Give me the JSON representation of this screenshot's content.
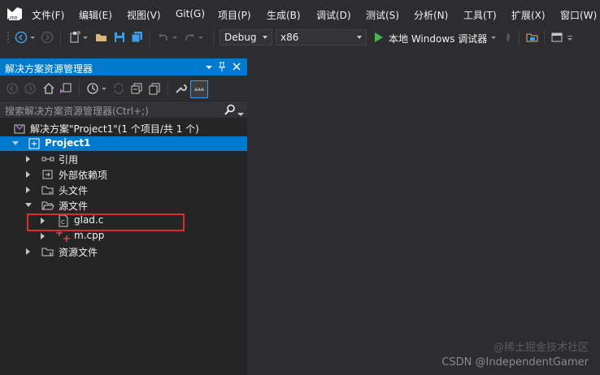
{
  "menubar": {
    "items": [
      "文件(F)",
      "编辑(E)",
      "视图(V)",
      "Git(G)",
      "项目(P)",
      "生成(B)",
      "调试(D)",
      "测试(S)",
      "分析(N)",
      "工具(T)",
      "扩展(X)",
      "窗口(W)"
    ],
    "logo_badge": "PRE"
  },
  "toolbar": {
    "config": "Debug",
    "platform": "x86",
    "run_label": "本地 Windows 调试器"
  },
  "solution_explorer": {
    "title": "解决方案资源管理器",
    "search_placeholder": "搜索解决方案资源管理器(Ctrl+;)",
    "solution_label": "解决方案\"Project1\"(1 个项目/共 1 个)",
    "project_label": "Project1",
    "nodes": [
      {
        "label": "引用",
        "icon": "references-icon"
      },
      {
        "label": "外部依赖项",
        "icon": "folder-icon"
      },
      {
        "label": "头文件",
        "icon": "folder-icon"
      },
      {
        "label": "源文件",
        "icon": "folder-open-icon"
      },
      {
        "label": "glad.c",
        "icon": "c-file-icon"
      },
      {
        "label": "m.cpp",
        "icon": "cpp-file-icon"
      },
      {
        "label": "资源文件",
        "icon": "folder-icon"
      }
    ]
  },
  "watermark": "CSDN @IndependentGamer",
  "watermark_overlay": "@稀土掘金技术社区",
  "colors": {
    "accent": "#007acc",
    "highlight_box": "#d9302f",
    "background": "#2d2d30",
    "panel": "#252526"
  }
}
